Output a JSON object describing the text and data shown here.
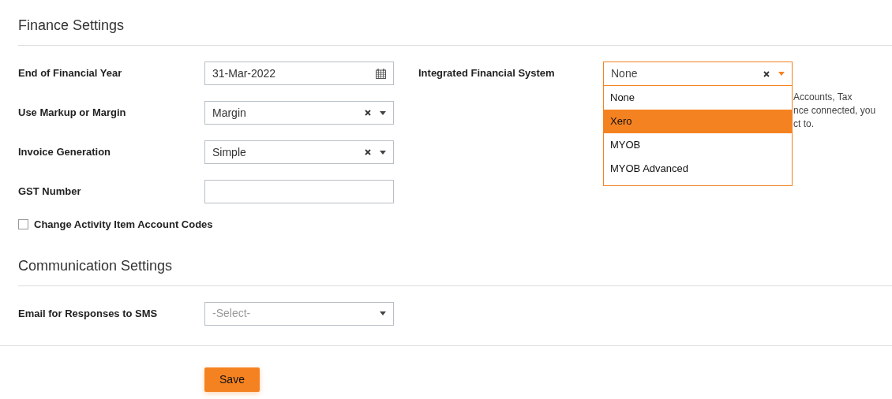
{
  "finance": {
    "heading": "Finance Settings",
    "fields": [
      {
        "kind": "date",
        "label": "End of Financial Year",
        "value": "31-Mar-2022"
      },
      {
        "kind": "select",
        "label": "Use Markup or Margin",
        "value": "Margin"
      },
      {
        "kind": "select",
        "label": "Invoice Generation",
        "value": "Simple"
      },
      {
        "kind": "text",
        "label": "GST Number"
      }
    ],
    "checkbox": {
      "label": "Change Activity Item Account Codes",
      "checked": false
    },
    "integration": {
      "label": "Integrated Financial System",
      "value": "None",
      "expanded": true,
      "options": [
        {
          "label": "None",
          "highlighted": false
        },
        {
          "label": "Xero",
          "highlighted": true
        },
        {
          "label": "MYOB",
          "highlighted": false
        },
        {
          "label": "MYOB Advanced",
          "highlighted": false
        }
      ],
      "help_lines": [
        "Accounts, Tax",
        "nce connected, you",
        "ct to."
      ]
    }
  },
  "communication": {
    "heading": "Communication Settings",
    "fields": [
      {
        "kind": "select",
        "label": "Email for Responses to SMS",
        "placeholder": "-Select-"
      }
    ]
  },
  "save_button": "Save"
}
